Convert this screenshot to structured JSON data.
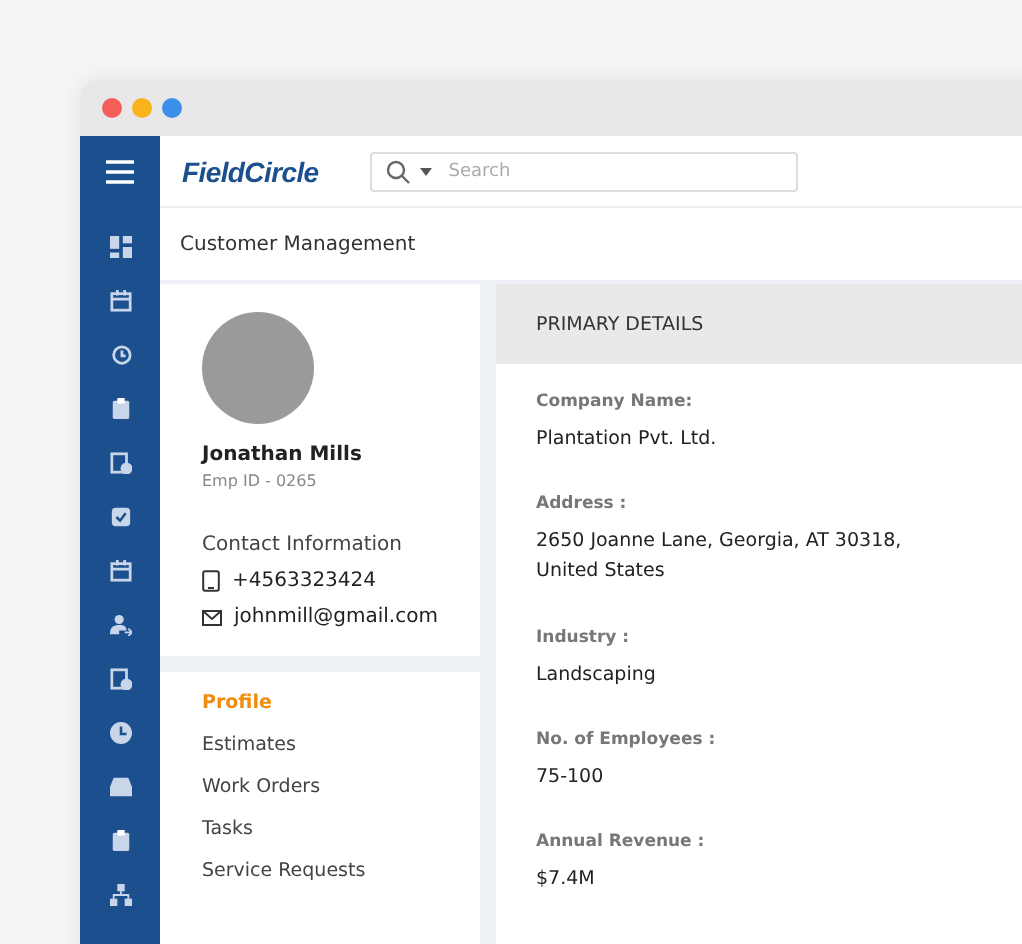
{
  "brand": {
    "name": "FieldCircle"
  },
  "search": {
    "placeholder": "Search"
  },
  "breadcrumb": "Customer Management",
  "profile": {
    "name": "Jonathan Mills",
    "emp_id": "Emp ID - 0265",
    "contact_heading": "Contact Information",
    "phone": "+4563323424",
    "email": "johnmill@gmail.com"
  },
  "menu": [
    {
      "label": "Profile",
      "selected": true
    },
    {
      "label": "Estimates",
      "selected": false
    },
    {
      "label": "Work Orders",
      "selected": false
    },
    {
      "label": "Tasks",
      "selected": false
    },
    {
      "label": "Service Requests",
      "selected": false
    }
  ],
  "details": {
    "heading": "PRIMARY DETAILS",
    "fields": [
      {
        "label": "Company Name:",
        "value": "Plantation Pvt. Ltd."
      },
      {
        "label": "Address :",
        "value": "2650 Joanne Lane, Georgia, AT 30318, United States"
      },
      {
        "label": "Industry :",
        "value": "Landscaping"
      },
      {
        "label": "No. of Employees :",
        "value": "75-100"
      },
      {
        "label": "Annual Revenue :",
        "value": "$7.4M"
      }
    ]
  }
}
